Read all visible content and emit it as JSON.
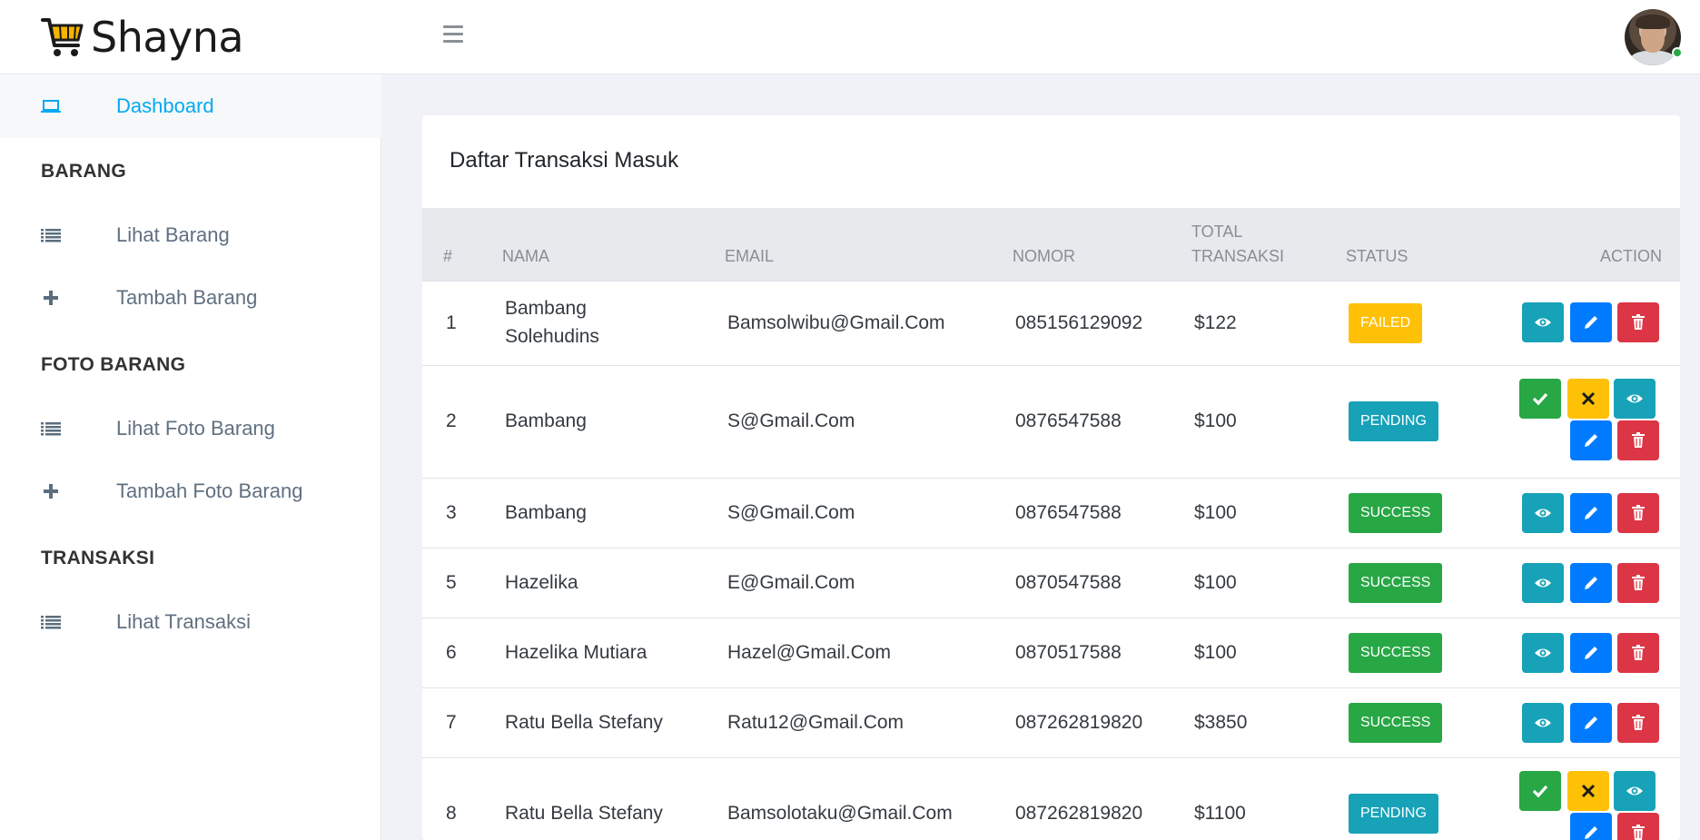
{
  "brand": {
    "name": "Shayna",
    "logo_icon": "shopping-cart-icon"
  },
  "header": {
    "menu_icon": "hamburger-icon",
    "avatar_status": "online"
  },
  "sidebar": {
    "dashboard": {
      "label": "Dashboard",
      "icon": "laptop-icon"
    },
    "sections": [
      {
        "heading": "BARANG",
        "items": [
          {
            "label": "Lihat Barang",
            "icon": "list-icon"
          },
          {
            "label": "Tambah Barang",
            "icon": "plus-icon"
          }
        ]
      },
      {
        "heading": "FOTO BARANG",
        "items": [
          {
            "label": "Lihat Foto Barang",
            "icon": "list-icon"
          },
          {
            "label": "Tambah Foto Barang",
            "icon": "plus-icon"
          }
        ]
      },
      {
        "heading": "TRANSAKSI",
        "items": [
          {
            "label": "Lihat Transaksi",
            "icon": "list-icon"
          }
        ]
      }
    ]
  },
  "card": {
    "title": "Daftar Transaksi Masuk",
    "columns": {
      "num": "#",
      "nama": "NAMA",
      "email": "EMAIL",
      "nomor": "NOMOR",
      "total_1": "TOTAL",
      "total_2": "TRANSAKSI",
      "status": "STATUS",
      "action": "ACTION"
    },
    "rows": [
      {
        "num": "1",
        "nama_1": "Bambang",
        "nama_2": "Solehudins",
        "email": "Bamsolwibu@Gmail.Com",
        "nomor": "085156129092",
        "total": "$122",
        "status": "FAILED"
      },
      {
        "num": "2",
        "nama_1": "Bambang",
        "nama_2": "",
        "email": "S@Gmail.Com",
        "nomor": "0876547588",
        "total": "$100",
        "status": "PENDING"
      },
      {
        "num": "3",
        "nama_1": "Bambang",
        "nama_2": "",
        "email": "S@Gmail.Com",
        "nomor": "0876547588",
        "total": "$100",
        "status": "SUCCESS"
      },
      {
        "num": "5",
        "nama_1": "Hazelika",
        "nama_2": "",
        "email": "E@Gmail.Com",
        "nomor": "0870547588",
        "total": "$100",
        "status": "SUCCESS"
      },
      {
        "num": "6",
        "nama_1": "Hazelika Mutiara",
        "nama_2": "",
        "email": "Hazel@Gmail.Com",
        "nomor": "0870517588",
        "total": "$100",
        "status": "SUCCESS"
      },
      {
        "num": "7",
        "nama_1": "Ratu Bella Stefany",
        "nama_2": "",
        "email": "Ratu12@Gmail.Com",
        "nomor": "087262819820",
        "total": "$3850",
        "status": "SUCCESS"
      },
      {
        "num": "8",
        "nama_1": "Ratu Bella Stefany",
        "nama_2": "",
        "email": "Bamsolotaku@Gmail.Com",
        "nomor": "087262819820",
        "total": "$1100",
        "status": "PENDING"
      }
    ],
    "action_icons": {
      "view": "eye-icon",
      "edit": "pencil-icon",
      "delete": "trash-icon",
      "approve": "check-icon",
      "reject": "x-icon"
    }
  },
  "colors": {
    "accent": "#03a9f3",
    "failed": "#ffc107",
    "pending": "#17a2b8",
    "success": "#28a745",
    "primary": "#007bff",
    "danger": "#dc3545"
  }
}
